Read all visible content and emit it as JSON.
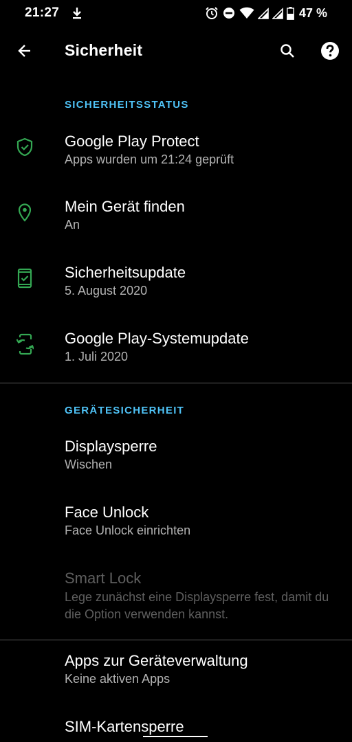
{
  "status_bar": {
    "time": "21:27",
    "battery_percent": "47 %",
    "icons": [
      "download-icon",
      "alarm-icon",
      "do-not-disturb-icon",
      "wifi-icon",
      "signal-icon",
      "signal-icon-2",
      "battery-icon"
    ]
  },
  "app_bar": {
    "title": "Sicherheit",
    "back_icon": "arrow-back-icon",
    "search_icon": "search-icon",
    "help_icon": "help-icon"
  },
  "colors": {
    "accent": "#4fc3f7",
    "icon_green": "#34a853",
    "background": "#000000",
    "secondary_text": "#b3b3b3",
    "disabled_text": "#5f5f5f",
    "divider": "#5a5a5a"
  },
  "sections": {
    "status": {
      "header": "SICHERHEITSSTATUS",
      "items": [
        {
          "title": "Google Play Protect",
          "subtitle": "Apps wurden um 21:24 geprüft",
          "icon": "shield-check-icon"
        },
        {
          "title": "Mein Gerät finden",
          "subtitle": "An",
          "icon": "location-pin-icon"
        },
        {
          "title": "Sicherheitsupdate",
          "subtitle": "5. August 2020",
          "icon": "phone-check-icon"
        },
        {
          "title": "Google Play-Systemupdate",
          "subtitle": "1. Juli 2020",
          "icon": "phone-sync-icon"
        }
      ]
    },
    "device": {
      "header": "GERÄTESICHERHEIT",
      "items": [
        {
          "title": "Displaysperre",
          "subtitle": "Wischen"
        },
        {
          "title": "Face Unlock",
          "subtitle": "Face Unlock einrichten"
        },
        {
          "title": "Smart Lock",
          "subtitle": "Lege zunächst eine Displaysperre fest, damit du die Option verwenden kannst."
        }
      ]
    },
    "more": {
      "items": [
        {
          "title": "Apps zur Geräteverwaltung",
          "subtitle": "Keine aktiven Apps"
        },
        {
          "title": "SIM-Kartensperre"
        }
      ]
    }
  }
}
